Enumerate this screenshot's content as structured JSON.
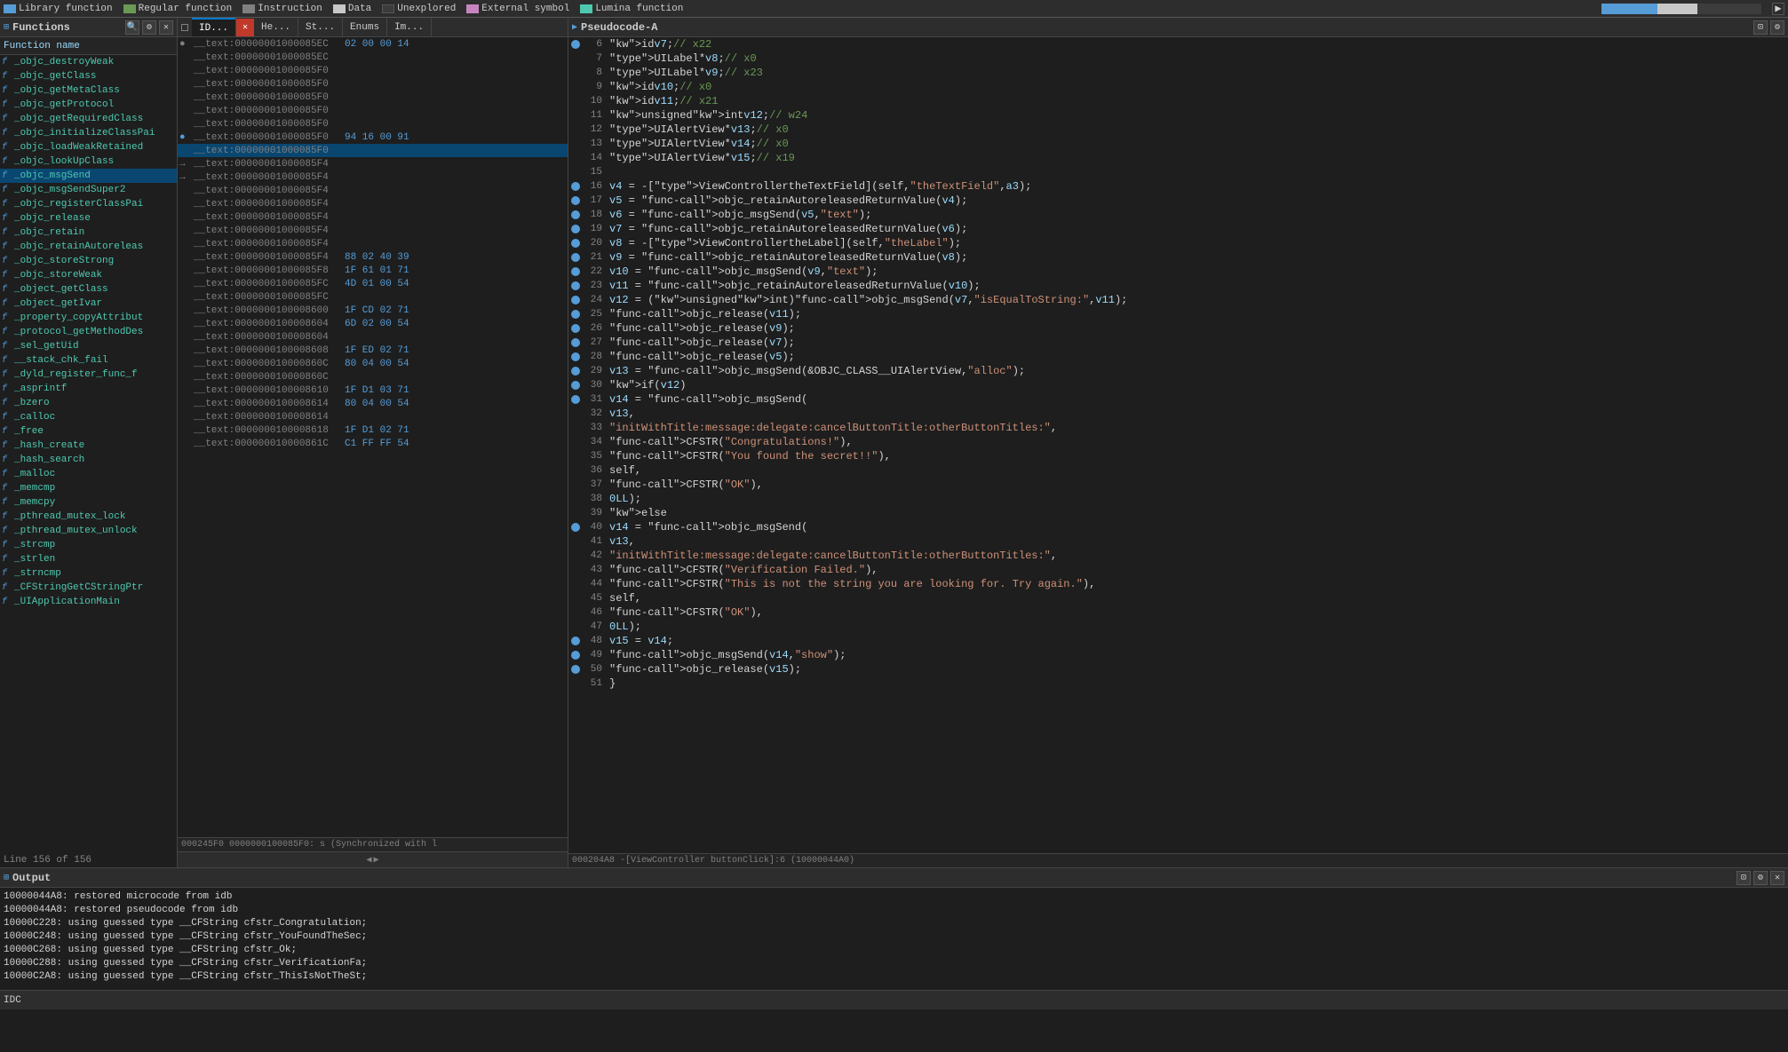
{
  "topbar": {
    "legend": [
      {
        "label": "Library function",
        "color": "#569cd6"
      },
      {
        "label": "Regular function",
        "color": "#6a9955"
      },
      {
        "label": "Instruction",
        "color": "#808080"
      },
      {
        "label": "Data",
        "color": "#c8c8c8"
      },
      {
        "label": "Unexplored",
        "color": "#3c3c3c"
      },
      {
        "label": "External symbol",
        "color": "#c586c0"
      },
      {
        "label": "Lumina function",
        "color": "#4ec9b0"
      }
    ]
  },
  "functions_panel": {
    "title": "Functions",
    "column_header": "Function name",
    "items": [
      "_objc_destroyWeak",
      "_objc_getClass",
      "_objc_getMetaClass",
      "_objc_getProtocol",
      "_objc_getRequiredClass",
      "_objc_initializeClassPai",
      "_objc_loadWeakRetained",
      "_objc_lookUpClass",
      "_objc_msgSend",
      "_objc_msgSendSuper2",
      "_objc_registerClassPai",
      "_objc_release",
      "_objc_retain",
      "_objc_retainAutoreleas",
      "_objc_storeStrong",
      "_objc_storeWeak",
      "_object_getClass",
      "_object_getIvar",
      "_property_copyAttribut",
      "_protocol_getMethodDes",
      "_sel_getUid",
      "__stack_chk_fail",
      "_dyld_register_func_f",
      "_asprintf",
      "_bzero",
      "_calloc",
      "_free",
      "_hash_create",
      "_hash_search",
      "_malloc",
      "_memcmp",
      "_memcpy",
      "_pthread_mutex_lock",
      "_pthread_mutex_unlock",
      "_strcmp",
      "_strlen",
      "_strncmp",
      "_CFStringGetCStringPtr",
      "_UIApplicationMain"
    ]
  },
  "disasm_panel": {
    "tabs": [
      "ID...",
      "He...",
      "St...",
      "Enums",
      "Im..."
    ],
    "lines": [
      {
        "addr": "__text:00000001000085EC",
        "bytes": "02 00 00 14",
        "highlighted": false
      },
      {
        "addr": "__text:00000001000085EC",
        "bytes": "",
        "highlighted": false
      },
      {
        "addr": "__text:00000001000085F0",
        "bytes": "",
        "highlighted": false
      },
      {
        "addr": "__text:00000001000085F0",
        "bytes": "",
        "highlighted": false
      },
      {
        "addr": "__text:00000001000085F0",
        "bytes": "",
        "highlighted": false
      },
      {
        "addr": "__text:00000001000085F0",
        "bytes": "",
        "highlighted": false
      },
      {
        "addr": "__text:00000001000085F0",
        "bytes": "",
        "highlighted": false
      },
      {
        "addr": "__text:00000001000085F0",
        "bytes": "94 16 00 91",
        "highlighted": false
      },
      {
        "addr": "__text:00000001000085F0",
        "bytes": "",
        "highlighted": true
      },
      {
        "addr": "__text:00000001000085F4",
        "bytes": "",
        "highlighted": false
      },
      {
        "addr": "__text:00000001000085F4",
        "bytes": "",
        "highlighted": false
      },
      {
        "addr": "__text:00000001000085F4",
        "bytes": "",
        "highlighted": false
      },
      {
        "addr": "__text:00000001000085F4",
        "bytes": "",
        "highlighted": false
      },
      {
        "addr": "__text:00000001000085F4",
        "bytes": "",
        "highlighted": false
      },
      {
        "addr": "__text:00000001000085F4",
        "bytes": "",
        "highlighted": false
      },
      {
        "addr": "__text:00000001000085F4",
        "bytes": "",
        "highlighted": false
      },
      {
        "addr": "__text:00000001000085F4",
        "bytes": "88 02 40 39",
        "highlighted": false
      },
      {
        "addr": "__text:00000001000085F8",
        "bytes": "1F 61 01 71",
        "highlighted": false
      },
      {
        "addr": "__text:00000001000085FC",
        "bytes": "4D 01 00 54",
        "highlighted": false
      },
      {
        "addr": "__text:00000001000085FC",
        "bytes": "",
        "highlighted": false
      },
      {
        "addr": "__text:0000000100008600",
        "bytes": "1F CD 02 71",
        "highlighted": false
      },
      {
        "addr": "__text:0000000100008604",
        "bytes": "6D 02 00 54",
        "highlighted": false
      },
      {
        "addr": "__text:0000000100008604",
        "bytes": "",
        "highlighted": false
      },
      {
        "addr": "__text:0000000100008608",
        "bytes": "1F ED 02 71",
        "highlighted": false
      },
      {
        "addr": "__text:000000010000860C",
        "bytes": "80 04 00 54",
        "highlighted": false
      },
      {
        "addr": "__text:000000010000860C",
        "bytes": "",
        "highlighted": false
      },
      {
        "addr": "__text:0000000100008610",
        "bytes": "1F D1 03 71",
        "highlighted": false
      },
      {
        "addr": "__text:0000000100008614",
        "bytes": "80 04 00 54",
        "highlighted": false
      },
      {
        "addr": "__text:0000000100008614",
        "bytes": "",
        "highlighted": false
      },
      {
        "addr": "__text:0000000100008618",
        "bytes": "1F D1 02 71",
        "highlighted": false
      },
      {
        "addr": "__text:000000010000861C",
        "bytes": "C1 FF FF 54",
        "highlighted": false
      }
    ],
    "status": "000245F0 0000000100085F0: s (Synchronized with l"
  },
  "pseudocode_panel": {
    "title": "Pseudocode-A",
    "lines": [
      {
        "num": "6",
        "dot": true,
        "code": "id v7; // x22"
      },
      {
        "num": "7",
        "dot": false,
        "code": "UILabel *v8; // x0"
      },
      {
        "num": "8",
        "dot": false,
        "code": "UILabel *v9; // x23"
      },
      {
        "num": "9",
        "dot": false,
        "code": "id v10; // x0"
      },
      {
        "num": "10",
        "dot": false,
        "code": "id v11; // x21"
      },
      {
        "num": "11",
        "dot": false,
        "code": "unsigned int v12; // w24"
      },
      {
        "num": "12",
        "dot": false,
        "code": "UIAlertView *v13; // x0"
      },
      {
        "num": "13",
        "dot": false,
        "code": "UIAlertView *v14; // x0"
      },
      {
        "num": "14",
        "dot": false,
        "code": "UIAlertView *v15; // x19"
      },
      {
        "num": "15",
        "dot": false,
        "code": ""
      },
      {
        "num": "16",
        "dot": true,
        "code": "v4 = -[ViewController theTextField](self, \"theTextField\", a3);"
      },
      {
        "num": "17",
        "dot": true,
        "code": "v5 = objc_retainAutoreleasedReturnValue(v4);"
      },
      {
        "num": "18",
        "dot": true,
        "code": "v6 = objc_msgSend(v5, \"text\");"
      },
      {
        "num": "19",
        "dot": true,
        "code": "v7 = objc_retainAutoreleasedReturnValue(v6);"
      },
      {
        "num": "20",
        "dot": true,
        "code": "v8 = -[ViewController theLabel](self, \"theLabel\");"
      },
      {
        "num": "21",
        "dot": true,
        "code": "v9 = objc_retainAutoreleasedReturnValue(v8);"
      },
      {
        "num": "22",
        "dot": true,
        "code": "v10 = objc_msgSend(v9, \"text\");"
      },
      {
        "num": "23",
        "dot": true,
        "code": "v11 = objc_retainAutoreleasedReturnValue(v10);"
      },
      {
        "num": "24",
        "dot": true,
        "code": "v12 = (unsigned int)objc_msgSend(v7, \"isEqualToString:\", v11);"
      },
      {
        "num": "25",
        "dot": true,
        "code": "objc_release(v11);"
      },
      {
        "num": "26",
        "dot": true,
        "code": "objc_release(v9);"
      },
      {
        "num": "27",
        "dot": true,
        "code": "objc_release(v7);"
      },
      {
        "num": "28",
        "dot": true,
        "code": "objc_release(v5);"
      },
      {
        "num": "29",
        "dot": true,
        "code": "v13 = objc_msgSend(&OBJC_CLASS__UIAlertView, \"alloc\");"
      },
      {
        "num": "30",
        "dot": true,
        "code": "if ( v12 )"
      },
      {
        "num": "31",
        "dot": true,
        "code": "  v14 = objc_msgSend("
      },
      {
        "num": "32",
        "dot": false,
        "code": "        v13,"
      },
      {
        "num": "33",
        "dot": false,
        "code": "        \"initWithTitle:message:delegate:cancelButtonTitle:otherButtonTitles:\","
      },
      {
        "num": "34",
        "dot": false,
        "code": "        CFSTR(\"Congratulations!\"),"
      },
      {
        "num": "35",
        "dot": false,
        "code": "        CFSTR(\"You found the secret!!\"),"
      },
      {
        "num": "36",
        "dot": false,
        "code": "        self,"
      },
      {
        "num": "37",
        "dot": false,
        "code": "        CFSTR(\"OK\"),"
      },
      {
        "num": "38",
        "dot": false,
        "code": "        0LL);"
      },
      {
        "num": "39",
        "dot": false,
        "code": "else"
      },
      {
        "num": "40",
        "dot": true,
        "code": "  v14 = objc_msgSend("
      },
      {
        "num": "41",
        "dot": false,
        "code": "        v13,"
      },
      {
        "num": "42",
        "dot": false,
        "code": "        \"initWithTitle:message:delegate:cancelButtonTitle:otherButtonTitles:\","
      },
      {
        "num": "43",
        "dot": false,
        "code": "        CFSTR(\"Verification Failed.\"),"
      },
      {
        "num": "44",
        "dot": false,
        "code": "        CFSTR(\"This is not the string you are looking for. Try again.\"),"
      },
      {
        "num": "45",
        "dot": false,
        "code": "        self,"
      },
      {
        "num": "46",
        "dot": false,
        "code": "        CFSTR(\"OK\"),"
      },
      {
        "num": "47",
        "dot": false,
        "code": "        0LL);"
      },
      {
        "num": "48",
        "dot": true,
        "code": "v15 = v14;"
      },
      {
        "num": "49",
        "dot": true,
        "code": "objc_msgSend(v14, \"show\");"
      },
      {
        "num": "50",
        "dot": true,
        "code": "objc_release(v15);"
      },
      {
        "num": "51",
        "dot": false,
        "code": "}"
      }
    ],
    "bottom_status": "000204A8 -[ViewController buttonClick]:6 (10000044A0)"
  },
  "output_panel": {
    "title": "Output",
    "lines": [
      "10000044A8: restored microcode from idb",
      "10000044A8: restored pseudocode from idb",
      "10000C228: using guessed type __CFString cfstr_Congratulation;",
      "10000C248: using guessed type __CFString cfstr_YouFoundTheSec;",
      "10000C268: using guessed type __CFString cfstr_Ok;",
      "10000C288: using guessed type __CFString cfstr_VerificationFa;",
      "10000C2A8: using guessed type __CFString cfstr_ThisIsNotTheSt;"
    ]
  },
  "lines_info": "Line 156 of 156",
  "idc_label": "IDC"
}
